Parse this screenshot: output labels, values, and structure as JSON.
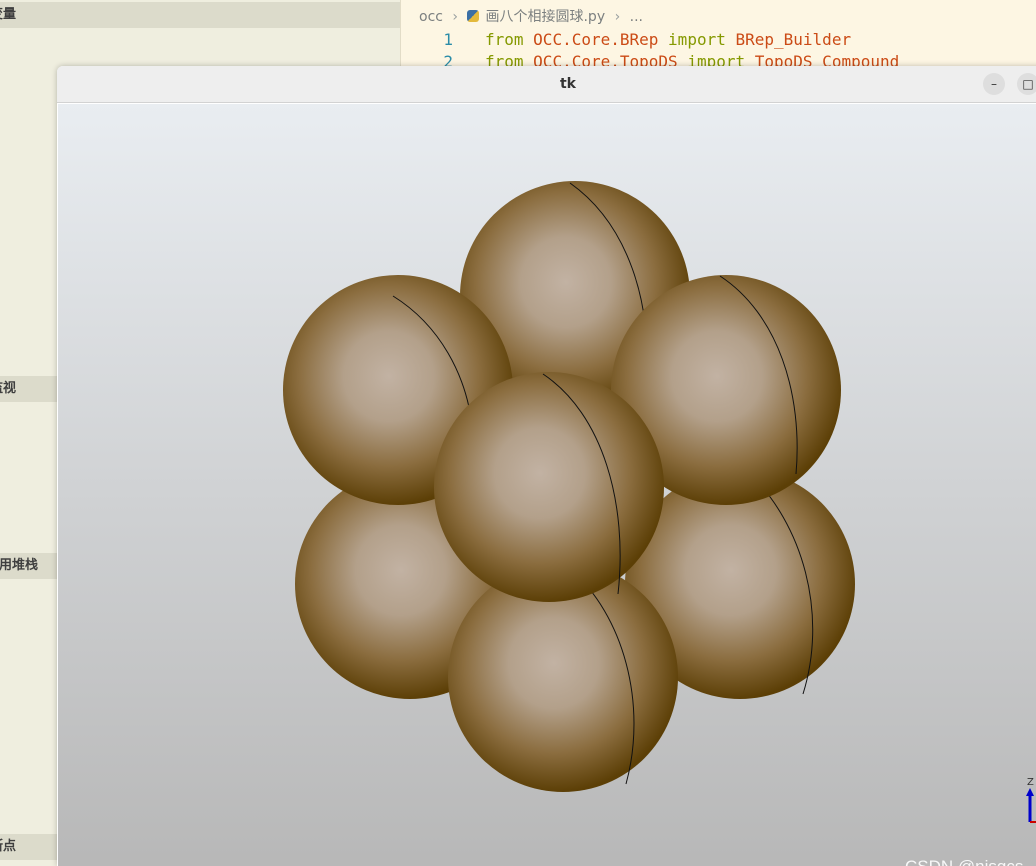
{
  "sidebar": {
    "sections": [
      "变量",
      "监视",
      "调用堆栈",
      "断点"
    ]
  },
  "editor": {
    "breadcrumb": {
      "folder": "occ",
      "file": "画八个相接圆球.py",
      "more": "..."
    },
    "lines": [
      {
        "num": "1",
        "kw1": "from",
        "module": "OCC.Core.BRep",
        "kw2": "import",
        "name": "BRep_Builder"
      },
      {
        "num": "2",
        "kw1": "from",
        "module": "OCC.Core.TopoDS",
        "kw2": "import",
        "name": "TopoDS_Compound"
      }
    ]
  },
  "window": {
    "title": "tk",
    "minimize_glyph": "–",
    "maximize_glyph": "□"
  },
  "scene": {
    "sphere_color": "#5c3f06",
    "highlight_color": "#c2b2a3",
    "sphere_count": 7
  },
  "axis_label": "Z",
  "watermark": "CSDN @njsgcs"
}
